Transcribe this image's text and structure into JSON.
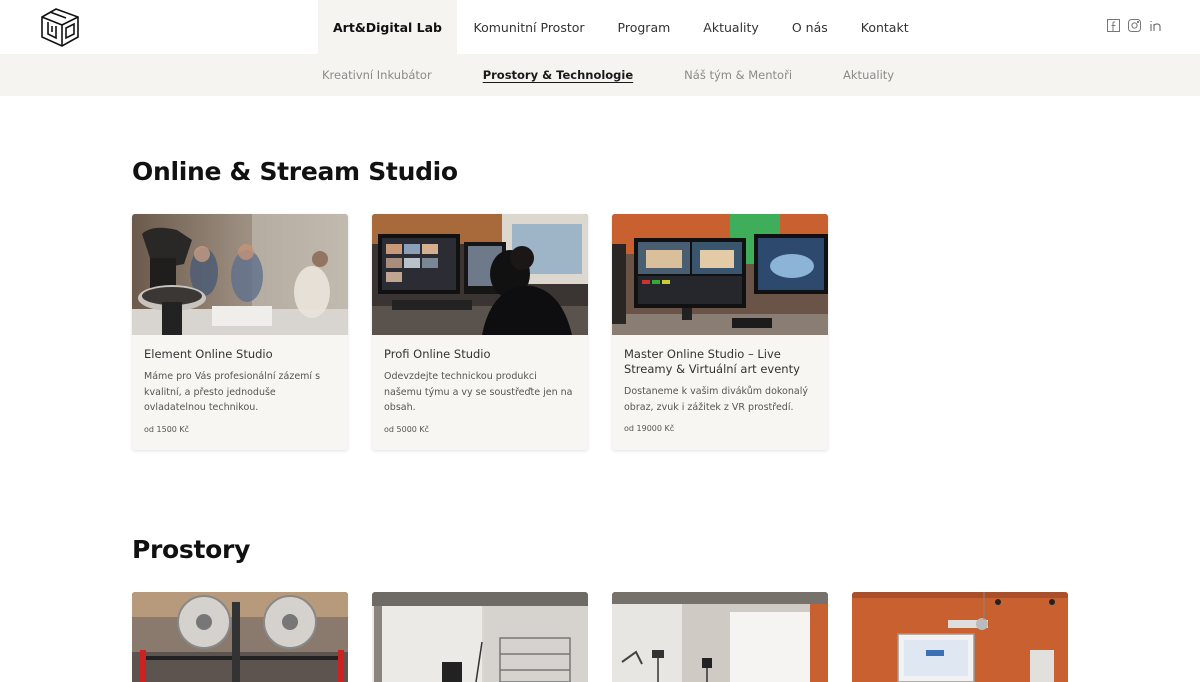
{
  "brand": {
    "logo_icon": "cube-logo-icon"
  },
  "main_nav": [
    {
      "label": "Art&Digital Lab",
      "active": true
    },
    {
      "label": "Komunitní Prostor"
    },
    {
      "label": "Program"
    },
    {
      "label": "Aktuality"
    },
    {
      "label": "O nás"
    },
    {
      "label": "Kontakt"
    }
  ],
  "social": [
    "facebook-icon",
    "instagram-icon",
    "linkedin-icon"
  ],
  "sub_nav": [
    {
      "label": "Kreativní Inkubátor"
    },
    {
      "label": "Prostory & Technologie",
      "active": true
    },
    {
      "label": "Náš tým & Mentoři"
    },
    {
      "label": "Aktuality"
    }
  ],
  "sections": {
    "online": {
      "title": "Online & Stream Studio",
      "cards": [
        {
          "title": "Element Online Studio",
          "desc": "Máme pro Vás profesionální zázemí s kvalitní, a přesto jednoduše ovladatelnou technikou.",
          "price": "od 1500 Kč"
        },
        {
          "title": "Profi Online Studio",
          "desc": "Odevzdejte technickou produkci našemu týmu a vy se soustřeďte jen na obsah.",
          "price": "od 5000 Kč"
        },
        {
          "title": "Master Online Studio – Live Streamy & Virtuální art eventy",
          "desc": "Dostaneme k vašim divákům dokonalý obraz, zvuk i zážitek z VR prostředí.",
          "price": "od 19000 Kč"
        }
      ]
    },
    "prostory": {
      "title": "Prostory"
    }
  },
  "colors": {
    "subbar_bg": "#f5f4f1",
    "card_bg": "#f7f6f3",
    "accent_orange": "#c9602f"
  }
}
